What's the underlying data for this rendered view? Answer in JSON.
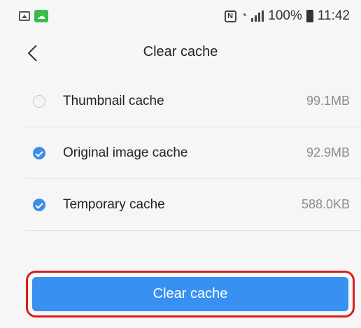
{
  "status_bar": {
    "battery": "100%",
    "time": "11:42",
    "nfc_letter": "N"
  },
  "header": {
    "title": "Clear cache"
  },
  "cache_items": [
    {
      "label": "Thumbnail cache",
      "size": "99.1MB",
      "checked": false
    },
    {
      "label": "Original image cache",
      "size": "92.9MB",
      "checked": true
    },
    {
      "label": "Temporary cache",
      "size": "588.0KB",
      "checked": true
    }
  ],
  "action": {
    "clear_label": "Clear cache"
  },
  "colors": {
    "accent": "#3891f0",
    "check": "#3a8ee6",
    "highlight_border": "#d81e1e"
  }
}
